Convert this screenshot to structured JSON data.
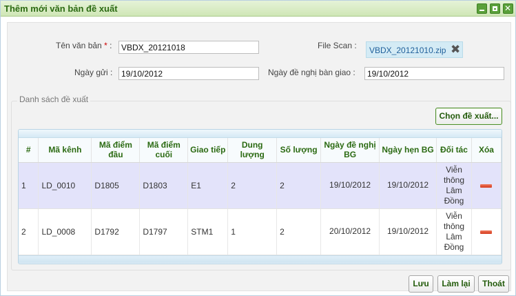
{
  "window": {
    "title": "Thêm mới văn bản đề xuất"
  },
  "form": {
    "name_label": "Tên văn bản",
    "required_mark": "*",
    "name_colon": ":",
    "name_value": "VBDX_20121018",
    "file_scan_label": "File Scan :",
    "file_name": "VBDX_20121010.zip",
    "sent_date_label": "Ngày gửi :",
    "sent_date_value": "19/10/2012",
    "handover_label": "Ngày đề nghị bàn giao :",
    "handover_value": "19/10/2012"
  },
  "proposals": {
    "legend": "Danh sách đề xuất",
    "choose_button": "Chọn đề xuất...",
    "columns": [
      "#",
      "Mã kênh",
      "Mã điểm đầu",
      "Mã điểm cuối",
      "Giao tiếp",
      "Dung lượng",
      "Số lượng",
      "Ngày đề nghị BG",
      "Ngày hẹn BG",
      "Đối tác",
      "Xóa"
    ],
    "rows": [
      {
        "num": "1",
        "channel": "LD_0010",
        "start": "D1805",
        "end": "D1803",
        "interface": "E1",
        "capacity": "2",
        "quantity": "2",
        "requested_date": "19/10/2012",
        "appointment_date": "19/10/2012",
        "partner": "Viễn thông Lâm Đồng"
      },
      {
        "num": "2",
        "channel": "LD_0008",
        "start": "D1792",
        "end": "D1797",
        "interface": "STM1",
        "capacity": "1",
        "quantity": "2",
        "requested_date": "20/10/2012",
        "appointment_date": "19/10/2012",
        "partner": "Viễn thông Lâm Đồng"
      }
    ]
  },
  "footer": {
    "save": "Lưu",
    "reset": "Làm lại",
    "exit": "Thoát"
  },
  "colors": {
    "title_green": "#2b6a12",
    "selected_row": "#e3e3fa",
    "file_chip": "#d4ebf5"
  },
  "icons": {
    "minimize": "minimize-icon",
    "maximize": "maximize-icon",
    "close": "close-icon",
    "remove_file": "remove-file-icon",
    "delete_row": "delete-row-icon"
  }
}
